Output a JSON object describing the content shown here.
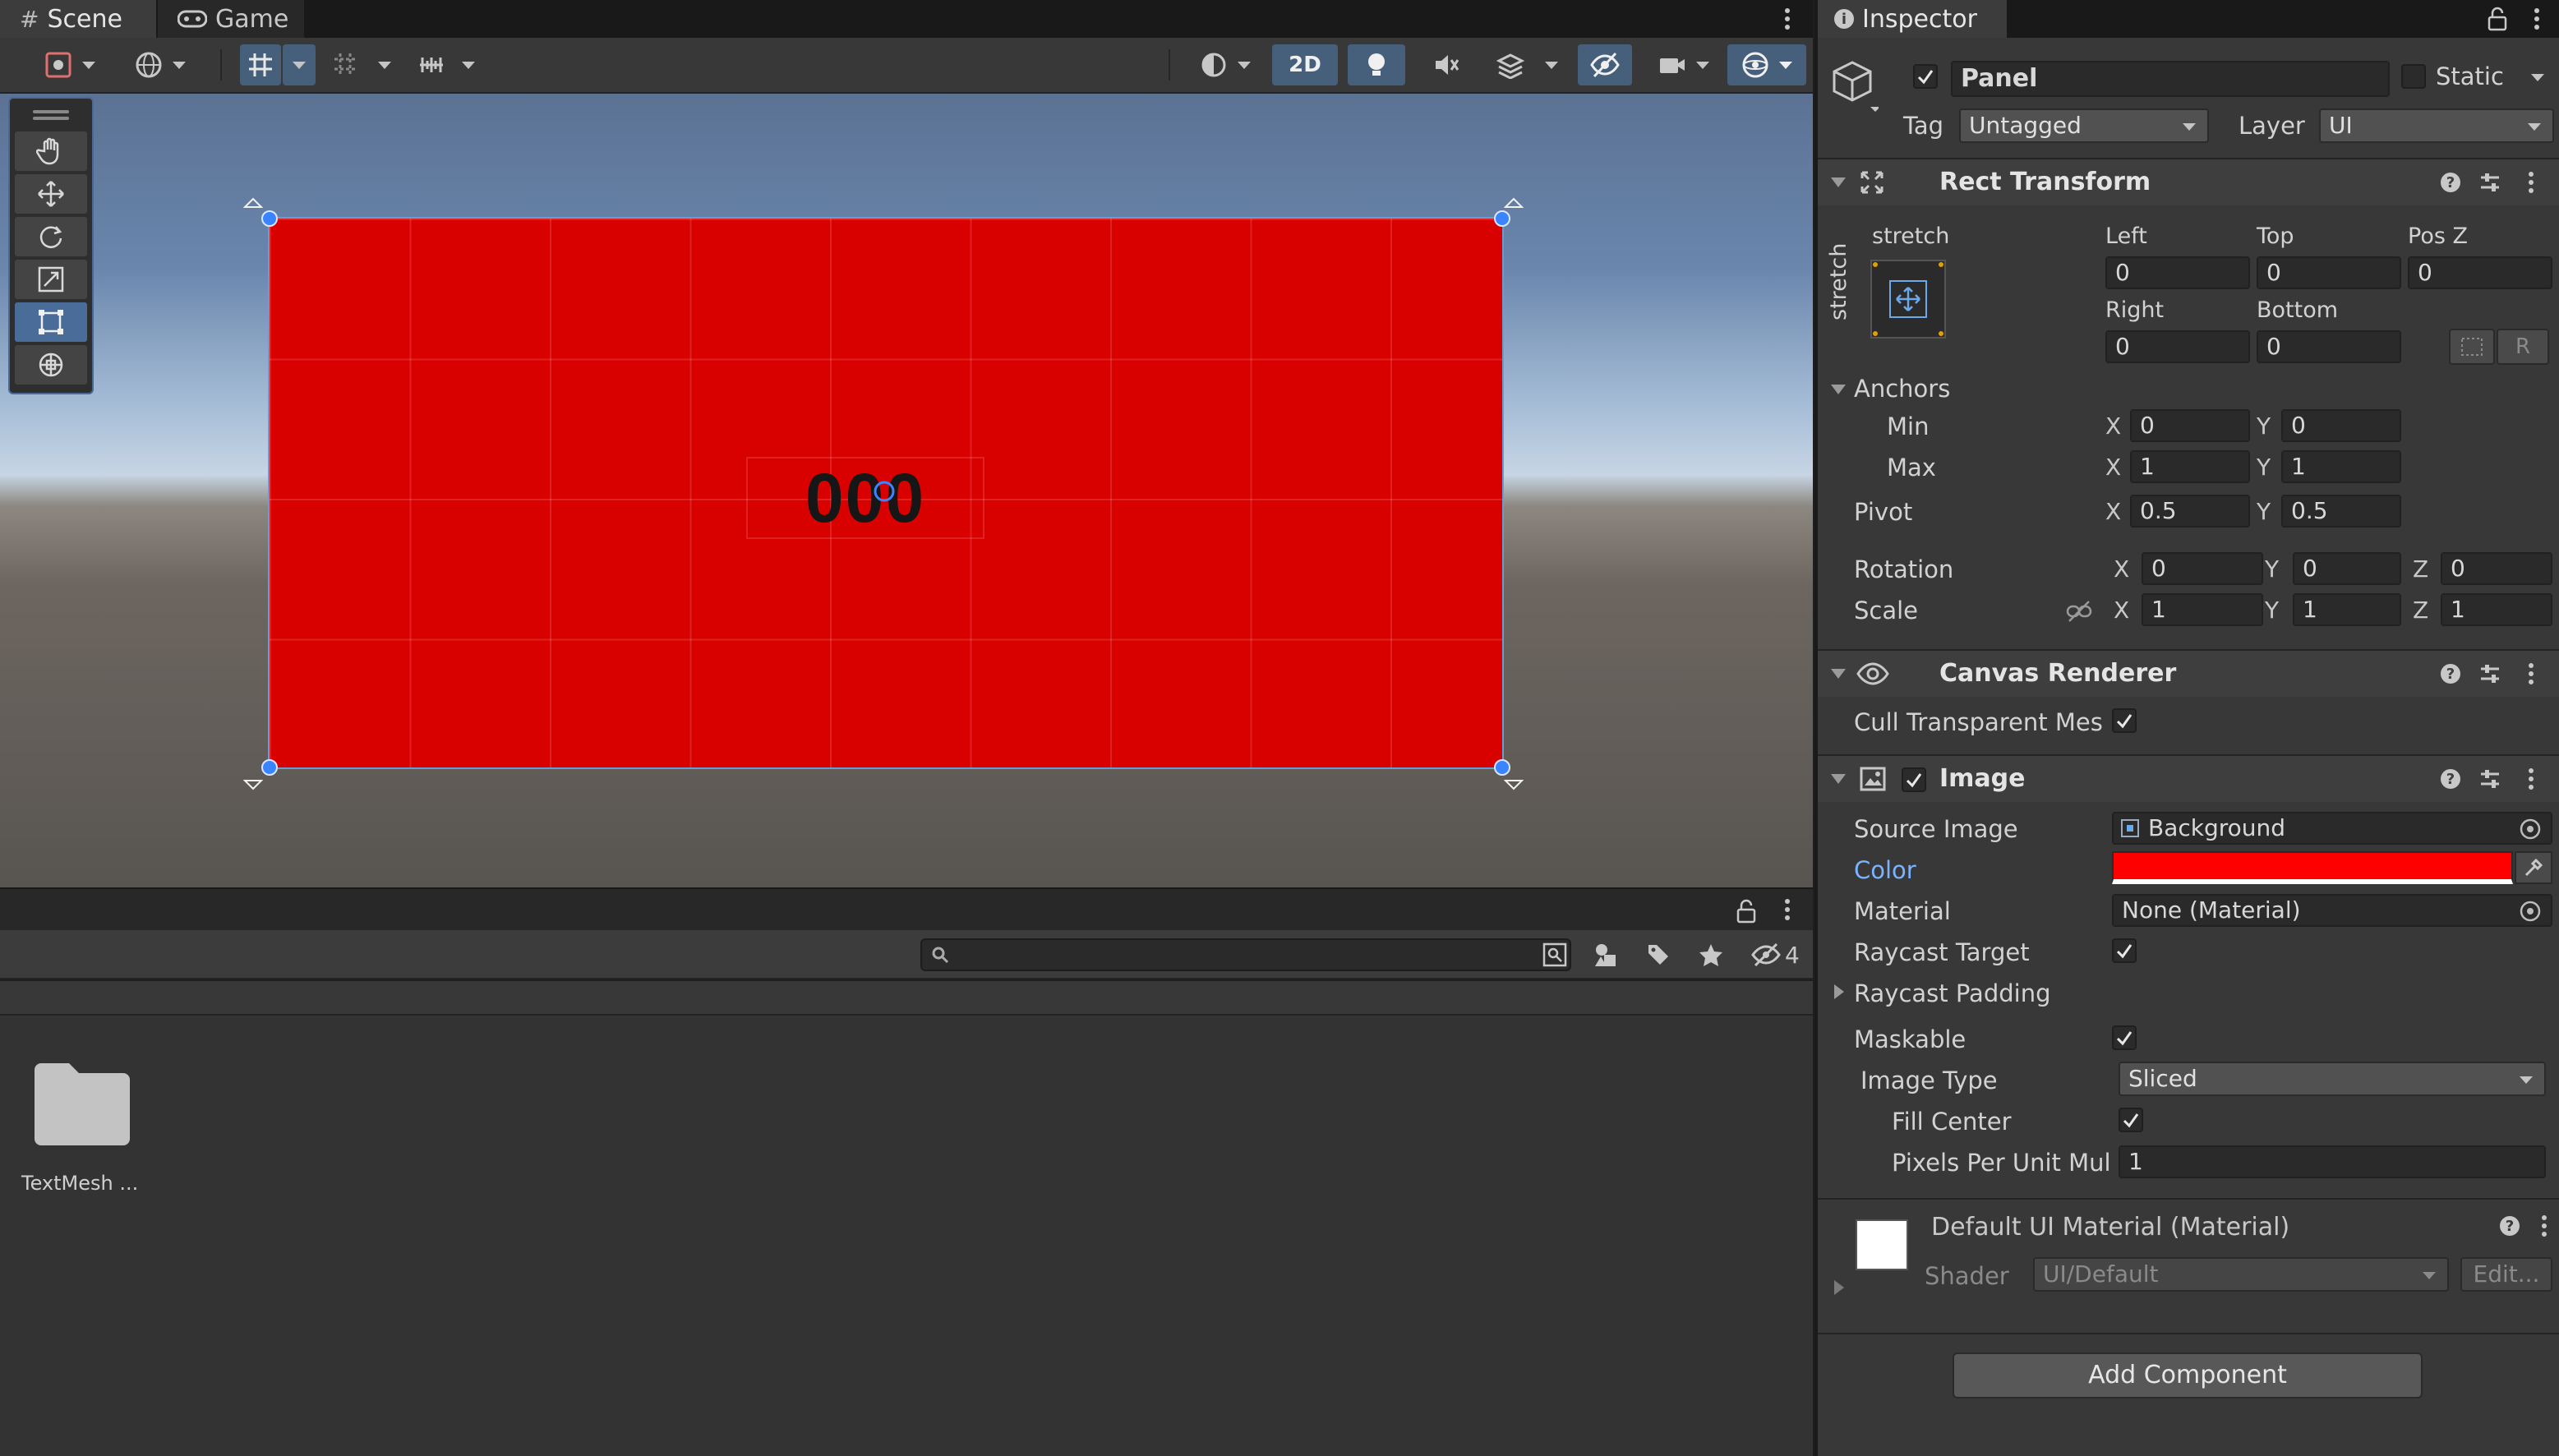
{
  "scene_tabs": [
    {
      "label": "Scene",
      "icon": "hash-icon"
    },
    {
      "label": "Game",
      "icon": "gamepad-icon"
    }
  ],
  "scene_toolbar": {
    "mode_2d": "2D"
  },
  "viewport": {
    "panel_color": "#d90000",
    "text": "000"
  },
  "project": {
    "visible_count": "4",
    "folder_label": "TextMesh ...",
    "search_placeholder": ""
  },
  "inspector": {
    "tab_title": "Inspector",
    "object_name": "Panel",
    "static_label": "Static",
    "tag_label": "Tag",
    "tag_value": "Untagged",
    "layer_label": "Layer",
    "layer_value": "UI",
    "rect_transform": {
      "title": "Rect Transform",
      "anchor_preset_top": "stretch",
      "anchor_preset_side": "stretch",
      "left_label": "Left",
      "left": "0",
      "top_label": "Top",
      "top": "0",
      "posz_label": "Pos Z",
      "posz": "0",
      "right_label": "Right",
      "right": "0",
      "bottom_label": "Bottom",
      "bottom": "0",
      "r_button": "R",
      "anchors_label": "Anchors",
      "min_label": "Min",
      "min_x": "0",
      "min_y": "0",
      "max_label": "Max",
      "max_x": "1",
      "max_y": "1",
      "pivot_label": "Pivot",
      "pivot_x": "0.5",
      "pivot_y": "0.5",
      "rotation_label": "Rotation",
      "rot_x": "0",
      "rot_y": "0",
      "rot_z": "0",
      "scale_label": "Scale",
      "scale_x": "1",
      "scale_y": "1",
      "scale_z": "1",
      "axis_x": "X",
      "axis_y": "Y",
      "axis_z": "Z"
    },
    "canvas_renderer": {
      "title": "Canvas Renderer",
      "cull_label": "Cull Transparent Mes"
    },
    "image": {
      "title": "Image",
      "source_label": "Source Image",
      "source_value": "Background",
      "color_label": "Color",
      "color_value": "#ff0000",
      "material_label": "Material",
      "material_value": "None (Material)",
      "raycast_target_label": "Raycast Target",
      "raycast_padding_label": "Raycast Padding",
      "maskable_label": "Maskable",
      "image_type_label": "Image Type",
      "image_type_value": "Sliced",
      "fill_center_label": "Fill Center",
      "ppu_label": "Pixels Per Unit Mul",
      "ppu_value": "1"
    },
    "material": {
      "title": "Default UI Material (Material)",
      "shader_label": "Shader",
      "shader_value": "UI/Default",
      "edit_label": "Edit..."
    },
    "add_component": "Add Component"
  }
}
